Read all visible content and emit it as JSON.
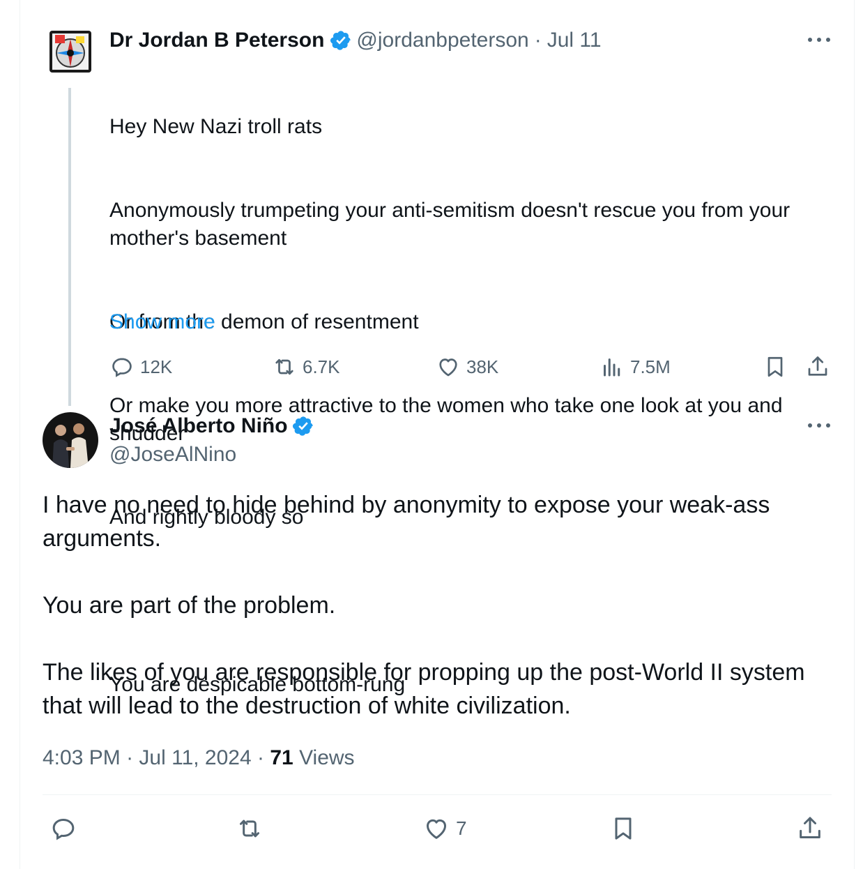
{
  "quoted": {
    "name": "Dr Jordan B Peterson",
    "handle": "@jordanbpeterson",
    "sep": "·",
    "date": "Jul 11",
    "body_lines": [
      "Hey New Nazi troll rats",
      "Anonymously trumpeting your anti-semitism doesn't rescue you from your mother's basement",
      "Or from the demon of resentment",
      "Or make you more attractive to the women who take one look at you and shudder",
      "And rightly bloody so",
      "",
      "You are despicable bottom-rung"
    ],
    "show_more": "Show more",
    "stats": {
      "replies": "12K",
      "reposts": "6.7K",
      "likes": "38K",
      "views": "7.5M"
    }
  },
  "reply": {
    "name": "José Alberto Niño",
    "handle": "@JoseAlNino",
    "paragraphs": [
      "I have no need to hide behind by anonymity to expose your weak-ass arguments.",
      "You are part of the problem.",
      "The likes of you are responsible for propping up the post-World II system that will lead to the destruction of white civilization."
    ],
    "time": "4:03 PM",
    "sep": "·",
    "date": "Jul 11, 2024",
    "views_count": "71",
    "views_label": "Views",
    "likes": "7"
  },
  "icons": {
    "verified": "verified-badge-icon",
    "more": "more-icon",
    "reply": "reply-icon",
    "repost": "repost-icon",
    "like": "heart-icon",
    "views": "analytics-icon",
    "bookmark": "bookmark-icon",
    "share": "share-icon"
  },
  "colors": {
    "accent": "#1d9bf0",
    "text": "#0f1419",
    "secondary": "#536471",
    "thread_line": "#cfd9de"
  }
}
